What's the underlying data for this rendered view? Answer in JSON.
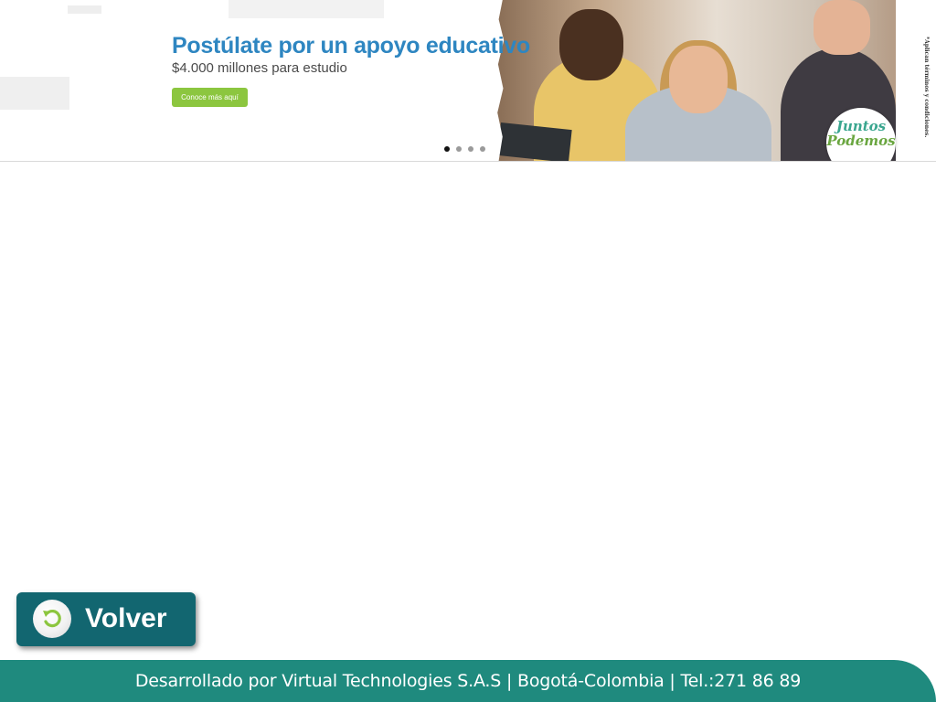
{
  "banner": {
    "title": "Postúlate por un apoyo educativo",
    "subtitle": "$4.000 millones para estudio",
    "cta_label": "Conoce más aquí",
    "logo_line1": "Juntos",
    "logo_line2": "Podemos",
    "disclaimer": "*Aplican términos y condiciones.",
    "slides_total": 4,
    "active_slide": 1,
    "colors": {
      "title": "#2e86c1",
      "cta": "#8cc63f"
    }
  },
  "volver": {
    "label": "Volver",
    "icon": "refresh-back-icon",
    "colors": {
      "background": "#126670",
      "icon": "#8cc63f"
    }
  },
  "footer": {
    "text": "Desarrollado por Virtual Technologies S.A.S | Bogotá-Colombia | Tel.:271 86 89",
    "color": "#1f8a7e"
  }
}
